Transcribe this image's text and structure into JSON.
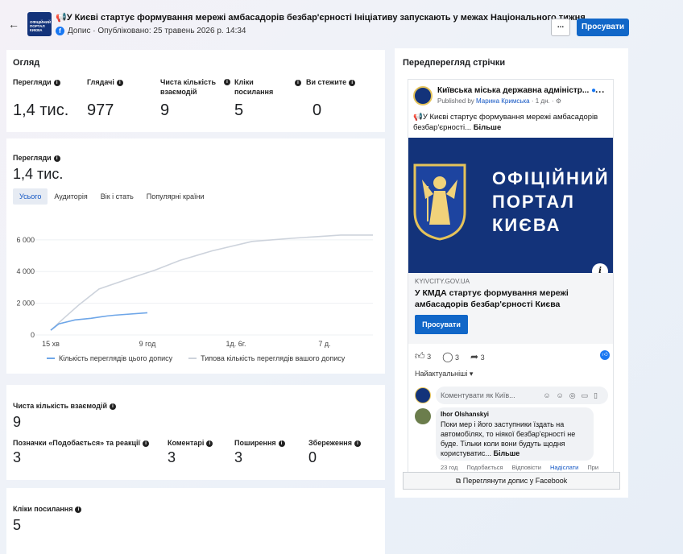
{
  "header": {
    "back_icon": "←",
    "title": "📢У Києві стартує формування мережі амбасадорів безбар'єрності Ініціативу запускають у межах Національного тижня ...",
    "thumb_text": "ОФІЦІЙНИЙ ПОРТАЛ КИЄВА",
    "meta": "Допис · Опубліковано: 25 травень 2026 р. 14:34",
    "more_label": "...",
    "promote_label": "Просувати"
  },
  "overview": {
    "title": "Огляд",
    "metrics": [
      {
        "label": "Перегляди",
        "value": "1,4 тис."
      },
      {
        "label": "Глядачі",
        "value": "977"
      },
      {
        "label": "Чиста кількість взаємодій",
        "value": "9"
      },
      {
        "label": "Кліки посилання",
        "value": "5"
      },
      {
        "label": "Ви стежите",
        "value": "0"
      }
    ]
  },
  "views": {
    "title": "Перегляди",
    "value": "1,4 тис.",
    "tabs": [
      "Усього",
      "Аудиторія",
      "Вік і стать",
      "Популярні країни"
    ],
    "active_tab": 0
  },
  "chart_data": {
    "type": "line",
    "x_ticks": [
      "15 хв",
      "9 год",
      "1д. 6г.",
      "7 д."
    ],
    "y_ticks": [
      "0",
      "2 000",
      "4 000",
      "6 000"
    ],
    "ylim": [
      0,
      6500
    ],
    "series": [
      {
        "name": "Кількість переглядів цього допису",
        "color": "#6ea6e8",
        "x": [
          0,
          0.1,
          0.3,
          0.5,
          0.7,
          0.8,
          1.2
        ],
        "values": [
          300,
          700,
          950,
          1050,
          1200,
          1250,
          1400
        ]
      },
      {
        "name": "Типова кількість переглядів вашого допису",
        "color": "#cdd3dc",
        "x": [
          0,
          0.15,
          0.35,
          0.6,
          1.0,
          1.3,
          1.6,
          2.0,
          2.5,
          3.0,
          3.3,
          3.6,
          4.0
        ],
        "values": [
          300,
          1000,
          1900,
          2900,
          3600,
          4100,
          4700,
          5300,
          5900,
          6100,
          6200,
          6300,
          6300
        ]
      }
    ]
  },
  "engagement": {
    "title": "Чиста кількість взаємодій",
    "value": "9",
    "metrics": [
      {
        "label": "Позначки «Подобається» та реакції",
        "value": "3"
      },
      {
        "label": "Коментарі",
        "value": "3"
      },
      {
        "label": "Поширення",
        "value": "3"
      },
      {
        "label": "Збереження",
        "value": "0"
      }
    ]
  },
  "link_clicks": {
    "title": "Кліки посилання",
    "value": "5"
  },
  "preview": {
    "title": "Передперегляд стрічки",
    "page_name": "Київська міська державна адміністр...",
    "published_by": "Published by",
    "author": "Марина Кримська",
    "time": "1 дн.",
    "post_text": "📢У Києві стартує формування мережі амбасадорів безбар'єрності...",
    "more": "Більше",
    "image_text": [
      "ОФІЦІЙНИЙ",
      "ПОРТАЛ",
      "КИЄВА"
    ],
    "link_domain": "KYIVCITY.GOV.UA",
    "link_title": "У КМДА стартує формування мережі амбасадорів безбар'єрності Києва",
    "promote_label": "Просувати",
    "likes": "3",
    "comments": "3",
    "shares": "3",
    "sort_label": "Найактуальніші",
    "comment_placeholder": "Коментувати як Київ...",
    "comment": {
      "author": "Ihor Olshanskyi",
      "text": "Поки мер і його заступники їздать на автомобілях, то ніякої безбар'єрності не буде. Тільки коли вони будуть щодня користуватис...",
      "more": "Більше",
      "time": "23 год",
      "actions": [
        "Подобається",
        "Відповісти",
        "Надіслати",
        "При"
      ]
    },
    "view_on_fb": "Переглянути допис у Facebook"
  }
}
